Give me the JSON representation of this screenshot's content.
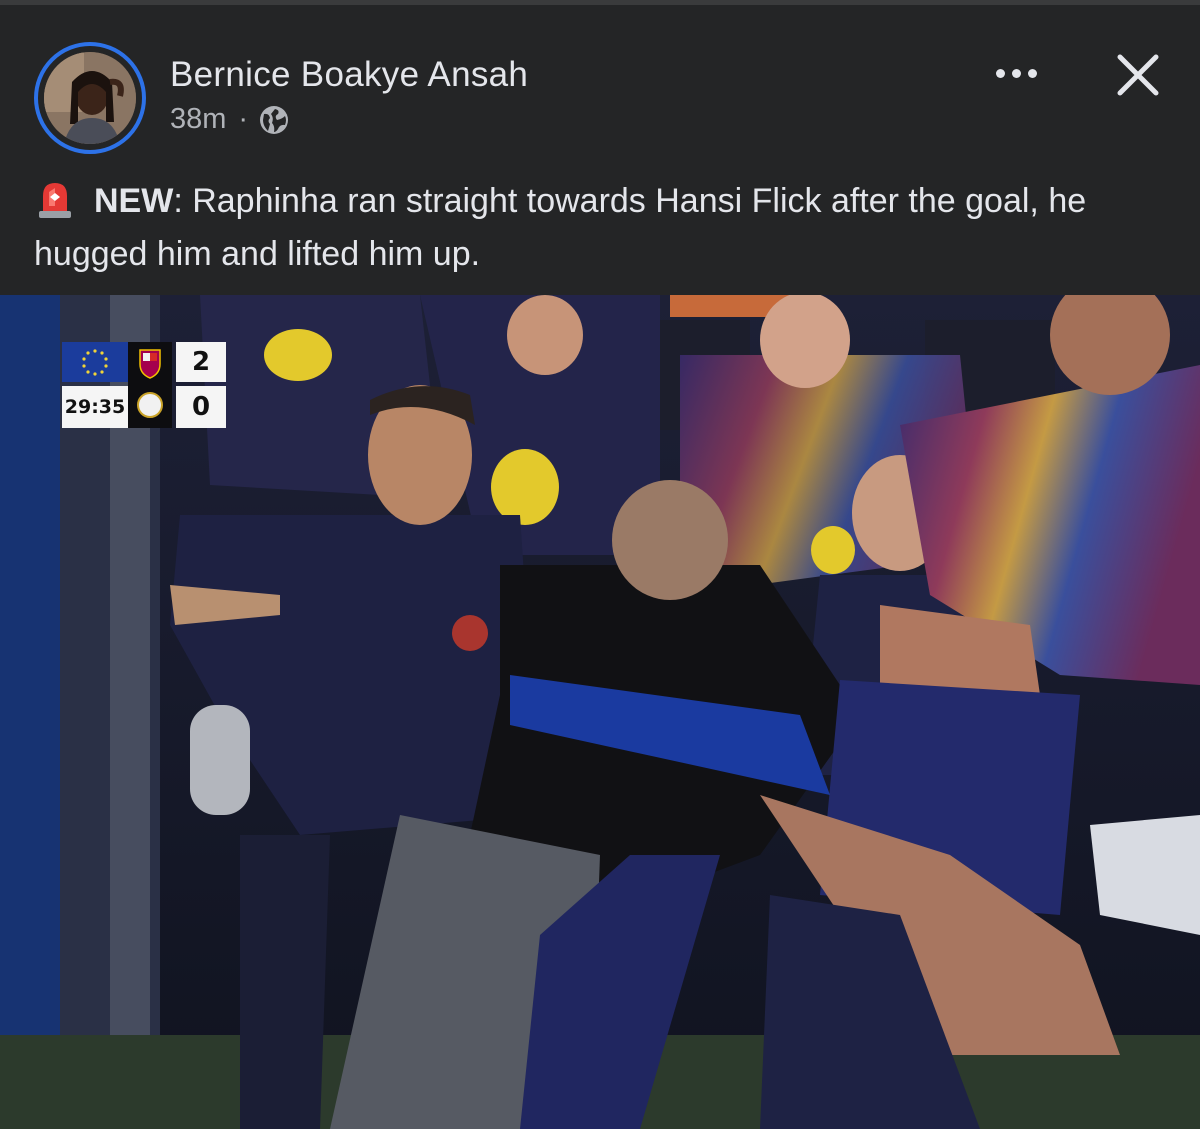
{
  "post": {
    "author": "Bernice Boakye Ansah",
    "time": "38m",
    "separator": "·",
    "text_prefix": "NEW",
    "text_body": ": Raphinha ran straight towards Hansi Flick after the goal, he hugged him and lifted him up."
  },
  "icons": {
    "privacy": "globe-icon",
    "more": "more-options-icon",
    "close": "close-icon",
    "alert": "siren-icon"
  },
  "scorebug": {
    "clock": "29:35",
    "home_score": "2",
    "away_score": "0"
  },
  "colors": {
    "background": "#242526",
    "avatar_ring": "#2d72e8",
    "text": "#e4e6eb",
    "secondary_text": "#b0b3b8"
  }
}
